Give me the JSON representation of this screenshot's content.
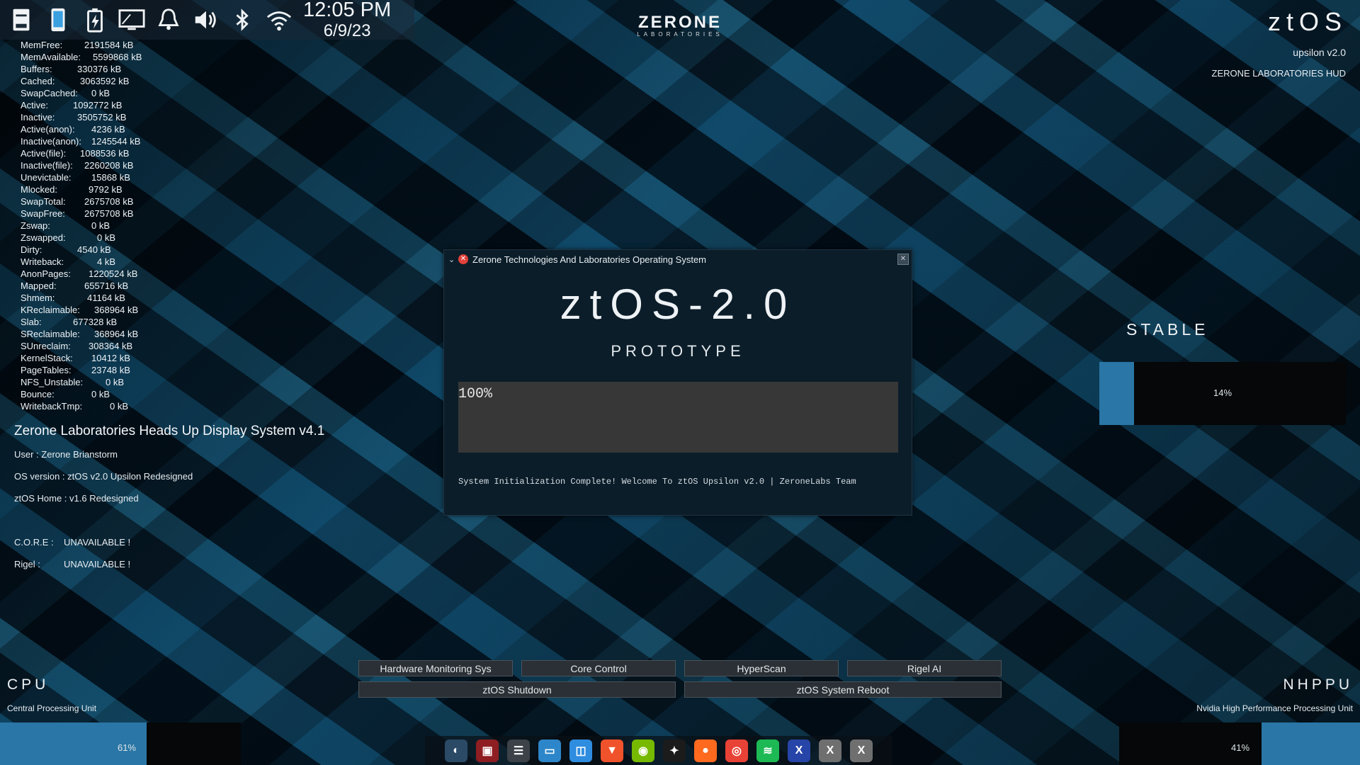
{
  "topbar": {
    "icons": [
      "storage-icon",
      "phone-icon",
      "battery-icon",
      "display-icon",
      "bell-icon",
      "volume-icon",
      "bluetooth-icon",
      "wifi-icon"
    ],
    "time": "12:05 PM",
    "date": "6/9/23"
  },
  "brand": {
    "name": "ZERONE",
    "sub": "LABORATORIES"
  },
  "topright": {
    "logo": "ztOS",
    "version": "upsilon v2.0",
    "hud": "ZERONE LABORATORIES HUD"
  },
  "meminfo": [
    {
      "k": "MemFree:",
      "v": "2191584 kB",
      "w": 90
    },
    {
      "k": "MemAvailable:",
      "v": "5599868 kB",
      "w": 102
    },
    {
      "k": "Buffers:",
      "v": "330376 kB",
      "w": 80
    },
    {
      "k": "Cached:",
      "v": "3063592 kB",
      "w": 84
    },
    {
      "k": "SwapCached:",
      "v": "0 kB",
      "w": 100
    },
    {
      "k": "Active:",
      "v": "1092772 kB",
      "w": 74
    },
    {
      "k": "Inactive:",
      "v": "3505752 kB",
      "w": 80
    },
    {
      "k": "Active(anon):",
      "v": "4236 kB",
      "w": 100
    },
    {
      "k": "Inactive(anon):",
      "v": "1245544 kB",
      "w": 100
    },
    {
      "k": "Active(file):",
      "v": "1088536 kB",
      "w": 84
    },
    {
      "k": "Inactive(file):",
      "v": "2260208 kB",
      "w": 90
    },
    {
      "k": "Unevictable:",
      "v": "15868 kB",
      "w": 100
    },
    {
      "k": "Mlocked:",
      "v": "9792 kB",
      "w": 96
    },
    {
      "k": "SwapTotal:",
      "v": "2675708 kB",
      "w": 90
    },
    {
      "k": "SwapFree:",
      "v": "2675708 kB",
      "w": 90
    },
    {
      "k": "Zswap:",
      "v": "0 kB",
      "w": 100
    },
    {
      "k": "Zswapped:",
      "v": "0 kB",
      "w": 108
    },
    {
      "k": "Dirty:",
      "v": "4540 kB",
      "w": 80
    },
    {
      "k": "Writeback:",
      "v": "4 kB",
      "w": 108
    },
    {
      "k": "AnonPages:",
      "v": "1220524 kB",
      "w": 96
    },
    {
      "k": "Mapped:",
      "v": "655716 kB",
      "w": 90
    },
    {
      "k": "Shmem:",
      "v": "41164 kB",
      "w": 94
    },
    {
      "k": "KReclaimable:",
      "v": "368964 kB",
      "w": 104
    },
    {
      "k": "Slab:",
      "v": "677328 kB",
      "w": 74
    },
    {
      "k": "SReclaimable:",
      "v": "368964 kB",
      "w": 104
    },
    {
      "k": "SUnreclaim:",
      "v": "308364 kB",
      "w": 96
    },
    {
      "k": "KernelStack:",
      "v": "10412 kB",
      "w": 100
    },
    {
      "k": "PageTables:",
      "v": "23748 kB",
      "w": 100
    },
    {
      "k": "NFS_Unstable:",
      "v": "0 kB",
      "w": 120
    },
    {
      "k": "Bounce:",
      "v": "0 kB",
      "w": 100
    },
    {
      "k": "WritebackTmp:",
      "v": "0 kB",
      "w": 126
    }
  ],
  "hud": {
    "title": "Zerone Laboratories Heads Up Display System v4.1",
    "user": "User : Zerone Brianstorm",
    "os": "OS version : ztOS v2.0 Upsilon Redesigned",
    "home": "ztOS Home : v1.6 Redesigned",
    "core_label": "C.O.R.E :",
    "core_value": "UNAVAILABLE !",
    "rigel_label": "Rigel :",
    "rigel_value": "UNAVAILABLE !"
  },
  "dialog": {
    "title": "Zerone Technologies And Laboratories Operating System",
    "heading": "ztOS-2.0",
    "subheading": "PROTOTYPE",
    "progress_text": "100%",
    "message": "System Initialization Complete! Welcome To ztOS Upsilon v2.0 | ZeroneLabs Team"
  },
  "stable": {
    "label": "STABLE",
    "percent_text": "14%",
    "fraction": 0.14
  },
  "buttons": {
    "hardware": "Hardware Monitoring Sys",
    "core": "Core Control",
    "hyperscan": "HyperScan",
    "rigel": "Rigel AI",
    "shutdown": "ztOS Shutdown",
    "reboot": "ztOS System Reboot"
  },
  "cpu": {
    "label": "CPU",
    "desc": "Central Processing Unit",
    "percent_text": "61%",
    "fraction": 0.61
  },
  "gpu": {
    "label": "NHPPU",
    "desc": "Nvidia High Performance Processing Unit",
    "percent_text": "41%",
    "fraction": 0.41
  },
  "dock": [
    {
      "name": "shell-app-icon",
      "glyph": "◐",
      "color": "#2b4a66"
    },
    {
      "name": "terminal-red-icon",
      "glyph": "▣",
      "color": "#8e1e22"
    },
    {
      "name": "settings-panel-icon",
      "glyph": "☰",
      "color": "#3c4248"
    },
    {
      "name": "file-manager-icon",
      "glyph": "▭",
      "color": "#2d86c9"
    },
    {
      "name": "store-icon",
      "glyph": "◫",
      "color": "#2f8de0"
    },
    {
      "name": "brave-browser-icon",
      "glyph": "▼",
      "color": "#f0532b"
    },
    {
      "name": "nvidia-icon",
      "glyph": "◉",
      "color": "#76b900"
    },
    {
      "name": "tidal-icon",
      "glyph": "✦",
      "color": "#1b1b1b"
    },
    {
      "name": "firefox-icon",
      "glyph": "●",
      "color": "#ff6a1f"
    },
    {
      "name": "chrome-icon",
      "glyph": "◎",
      "color": "#e84236"
    },
    {
      "name": "spotify-icon",
      "glyph": "≋",
      "color": "#1db954"
    },
    {
      "name": "custom-app-icon",
      "glyph": "X",
      "color": "#2744a8"
    },
    {
      "name": "xorg-icon",
      "glyph": "X",
      "color": "#6f6f6f"
    },
    {
      "name": "xorg-icon-2",
      "glyph": "X",
      "color": "#6f6f6f"
    }
  ]
}
